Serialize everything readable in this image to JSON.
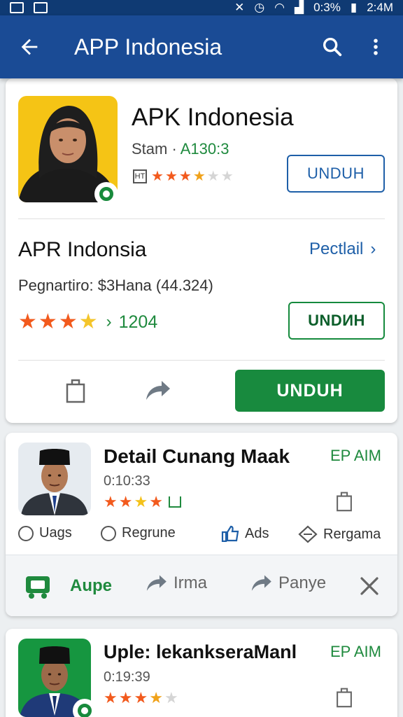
{
  "status_bar": {
    "battery": "0:3%",
    "time": "2:4M"
  },
  "appbar": {
    "title": "APP Indonesia"
  },
  "card1": {
    "app_title": "APK Indonesia",
    "subtitle_prefix": "Stam ·",
    "subtitle_value": "A130:3",
    "rating_tag": "HT",
    "stars": [
      1,
      1,
      1,
      0.5,
      0.3,
      0
    ],
    "download_label": "UNDUH",
    "section_title": "APR Indonsia",
    "detail_link": "Pectlail",
    "publisher": "Pegnartiro: $3Hana (44.324)",
    "rating_count": "1204",
    "download_label_2": "UNDИH",
    "download_big": "UNDUH"
  },
  "card2": {
    "title": "Detail Cunang Maak",
    "time": "0:10:33",
    "tag": "EP AIM",
    "chips": [
      "Uags",
      "Regrune",
      "Ads",
      "Rergama"
    ],
    "actions": [
      "Aupe",
      "Irma",
      "Panye"
    ]
  },
  "card3": {
    "title": "Uple: lekankseraManl",
    "time": "0:19:39",
    "tag": "EP AIM"
  },
  "colors": {
    "appbar": "#1a4b95",
    "accent_green": "#188a3e",
    "star_orange": "#f25a1d",
    "link_blue": "#1e5fa8"
  }
}
